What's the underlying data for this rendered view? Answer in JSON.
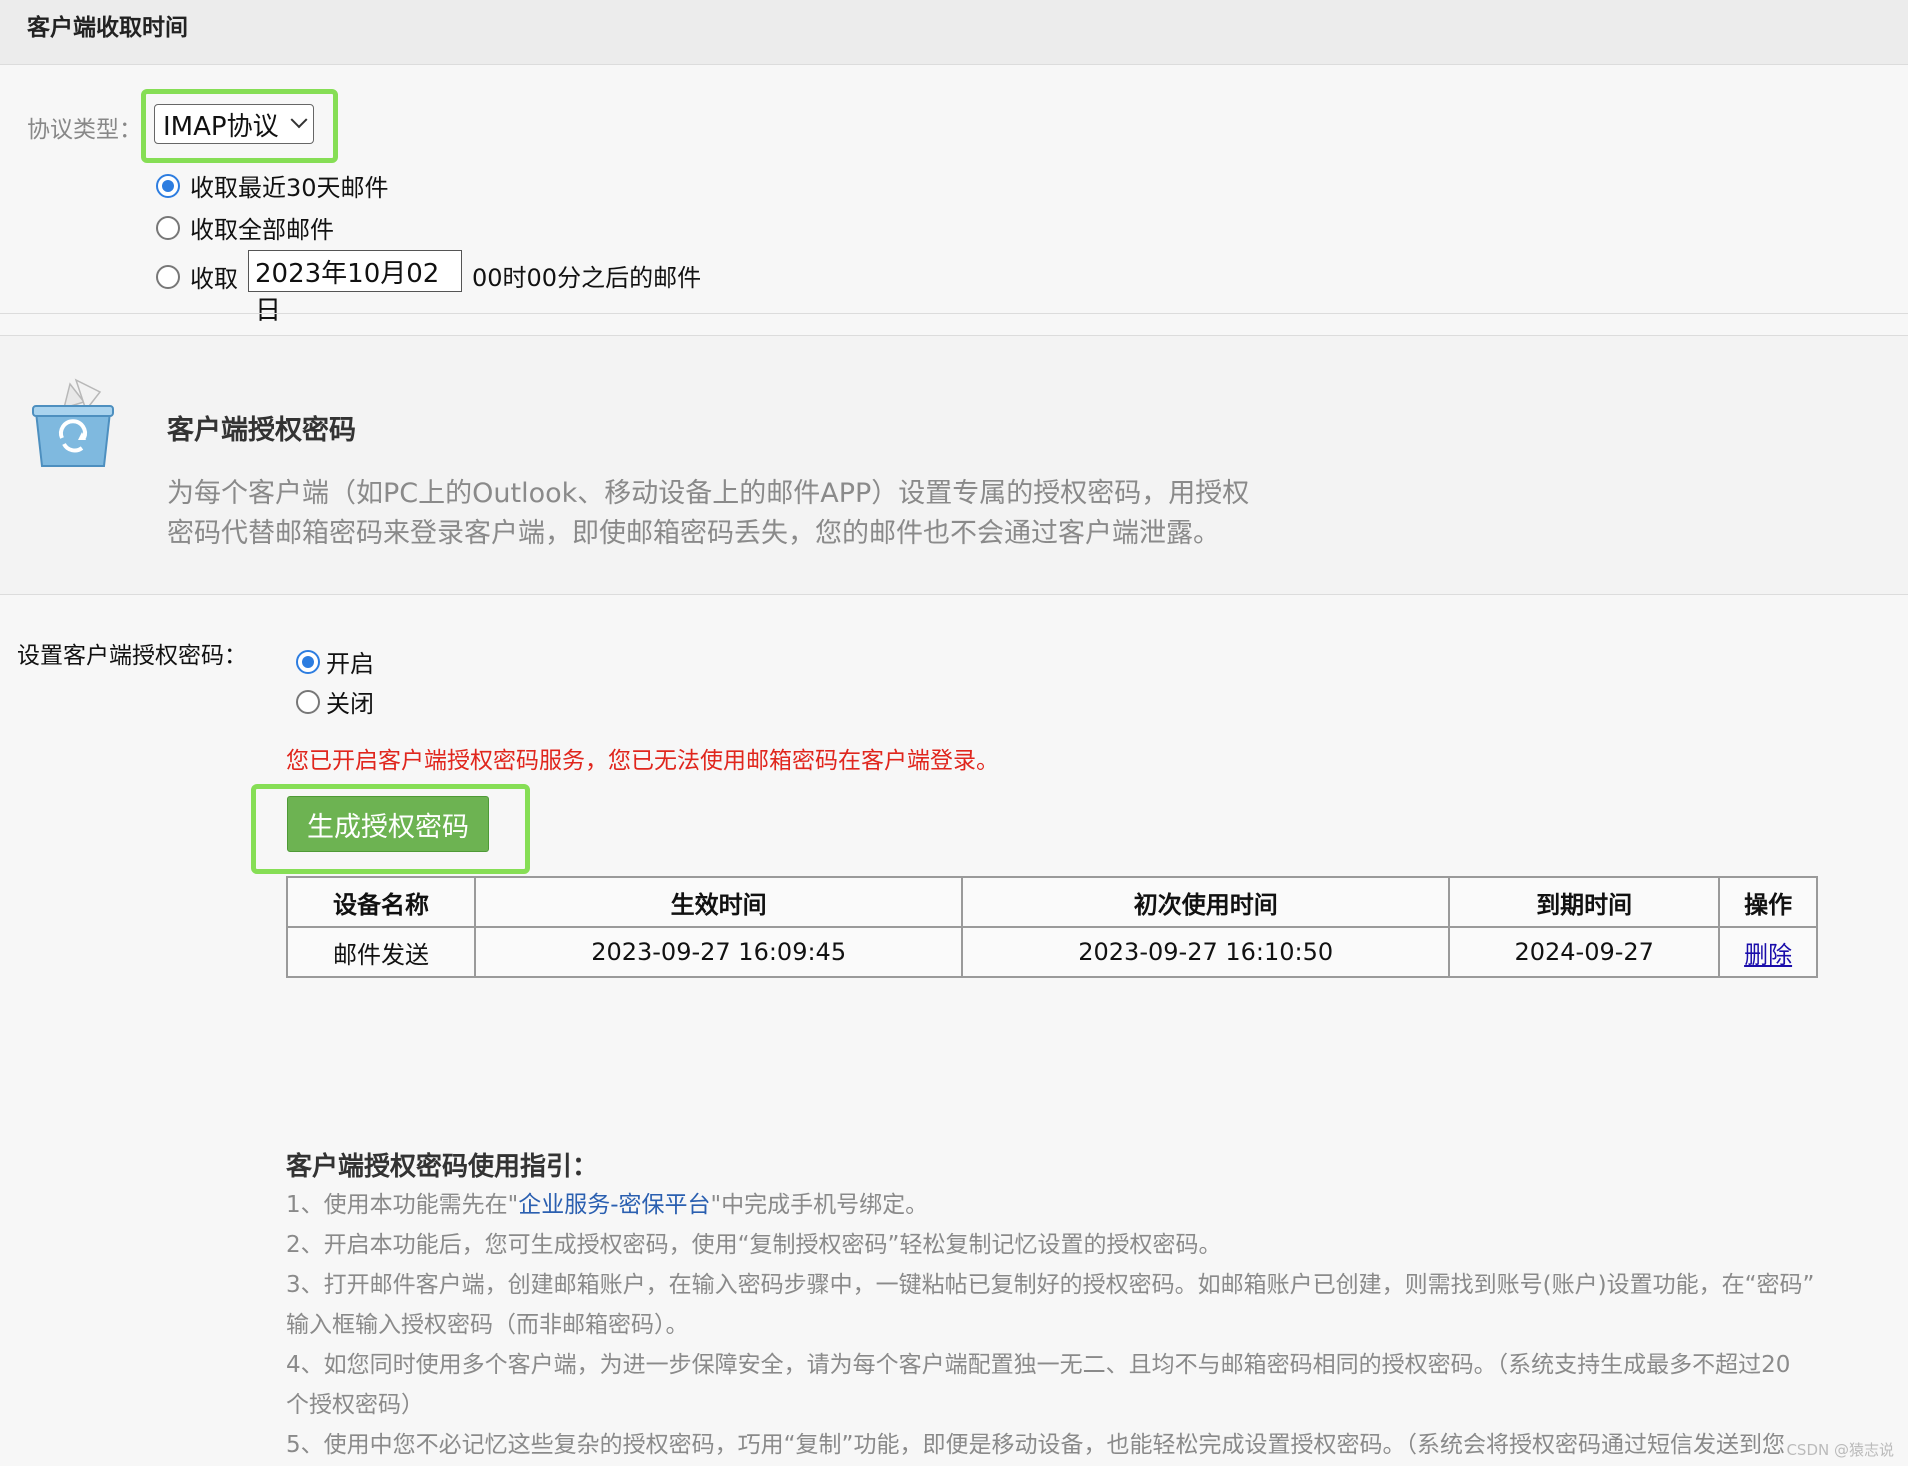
{
  "header": {
    "title": "客户端收取时间"
  },
  "protocol": {
    "label": "协议类型：",
    "selected": "IMAP协议",
    "options": [
      {
        "label": "收取最近30天邮件",
        "checked": true
      },
      {
        "label": "收取全部邮件",
        "checked": false
      }
    ],
    "custom": {
      "prefix": "收取",
      "date": "2023年10月02日",
      "suffix": "00时00分之后的邮件"
    }
  },
  "intro": {
    "title": "客户端授权密码",
    "line1": "为每个客户端（如PC上的Outlook、移动设备上的邮件APP）设置专属的授权密码，用授权",
    "line2": "密码代替邮箱密码来登录客户端，即使邮箱密码丢失，您的邮件也不会通过客户端泄露。",
    "icon": "recycle-box-icon"
  },
  "settings": {
    "label": "设置客户端授权密码：",
    "on_label": "开启",
    "off_label": "关闭",
    "enabled": true,
    "warning": "您已开启客户端授权密码服务，您已无法使用邮箱密码在客户端登录。",
    "generate_button": "生成授权密码"
  },
  "table": {
    "headers": [
      "设备名称",
      "生效时间",
      "初次使用时间",
      "到期时间",
      "操作"
    ],
    "rows": [
      [
        "邮件发送",
        "2023-09-27 16:09:45",
        "2023-09-27 16:10:50",
        "2024-09-27",
        "删除"
      ]
    ]
  },
  "guide": {
    "title": "客户端授权密码使用指引：",
    "item1_pre": "1、使用本功能需先在\"",
    "item1_link": "企业服务-密保平台",
    "item1_post": "\"中完成手机号绑定。",
    "item2": "2、开启本功能后，您可生成授权密码，使用“复制授权密码”轻松复制记忆设置的授权密码。",
    "item3a": "3、打开邮件客户端，创建邮箱账户，在输入密码步骤中，一键粘帖已复制好的授权密码。如邮箱账户已创建，则需找到账号(账户)设置功能，在“密码”",
    "item3b": "输入框输入授权密码（而非邮箱密码）。",
    "item4a": "4、如您同时使用多个客户端，为进一步保障安全，请为每个客户端配置独一无二、且均不与邮箱密码相同的授权密码。（系统支持生成最多不超过20",
    "item4b": "个授权密码）",
    "item5": "5、使用中您不必记忆这些复杂的授权密码，巧用“复制”功能，即便是移动设备，也能轻松完成设置授权密码。（系统会将授权密码通过短信发送到您"
  },
  "watermark": "CSDN @猿志说",
  "colors": {
    "accent_green": "#6db352",
    "highlight": "#86de55",
    "warning": "#e0261d",
    "radio_blue": "#2d7de0"
  }
}
